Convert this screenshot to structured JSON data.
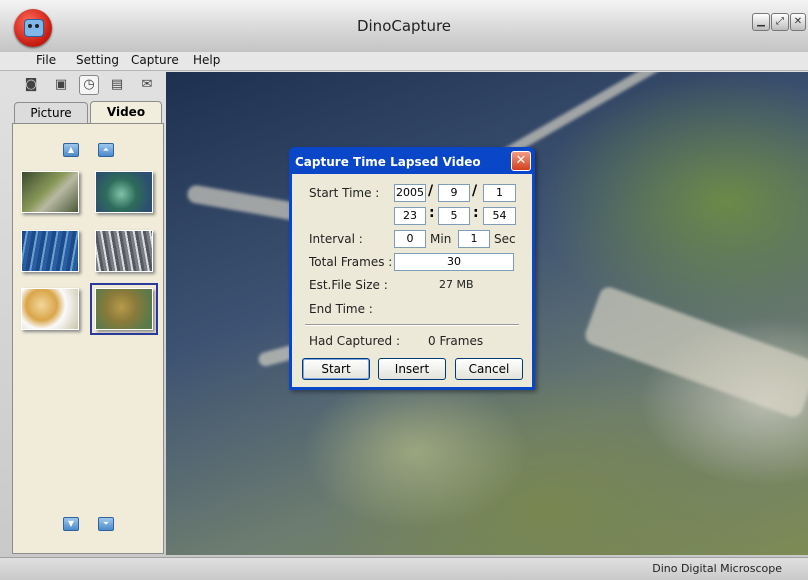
{
  "app": {
    "title": "DinoCapture",
    "logo_icon": "dino-robot-logo-icon",
    "window_controls": [
      {
        "icon": "minimize-icon",
        "glyph": "▁"
      },
      {
        "icon": "maximize-icon",
        "glyph": "⤢"
      },
      {
        "icon": "close-icon",
        "glyph": "✕"
      }
    ]
  },
  "menu": {
    "file": "File",
    "setting": "Setting",
    "capture": "Capture",
    "help": "Help"
  },
  "toolbar": {
    "tools": [
      {
        "icon": "camera-icon",
        "glyph": "◙"
      },
      {
        "icon": "video-camera-icon",
        "glyph": "▣"
      },
      {
        "icon": "clock-icon",
        "glyph": "◷"
      },
      {
        "icon": "save-icon",
        "glyph": "▤"
      },
      {
        "icon": "email-icon",
        "glyph": "✉"
      }
    ]
  },
  "side_panel": {
    "tabs": {
      "picture": "Picture",
      "video": "Video"
    },
    "active_tab": "Video",
    "thumbnail_count": 6,
    "selected_thumbnail": 6
  },
  "status_bar": {
    "text": "Dino Digital Microscope"
  },
  "dialog": {
    "title": "Capture Time Lapsed Video",
    "start_time_label": "Start Time :",
    "start_year": "2005",
    "start_month": "9",
    "start_day": "1",
    "date_separator": "/",
    "start_hour": "23",
    "start_minute": "5",
    "start_second": "54",
    "time_separator": ":",
    "interval_label": "Interval :",
    "interval_min": "0",
    "interval_min_unit": "Min",
    "interval_sec": "1",
    "interval_sec_unit": "Sec",
    "total_frames_label": "Total Frames :",
    "total_frames": "30",
    "est_file_size_label": "Est.File Size :",
    "est_file_size": "27 MB",
    "end_time_label": "End Time :",
    "had_captured_label": "Had Captured :",
    "had_captured_value": "0 Frames",
    "start_button": "Start",
    "insert_button": "Insert",
    "cancel_button": "Cancel",
    "close_glyph": "✕"
  },
  "colors": {
    "dialog_title_bar": "#0a46c8",
    "dialog_body": "#ece9d8",
    "panel_background": "#f1ecd9",
    "logo": "#c4190f"
  }
}
